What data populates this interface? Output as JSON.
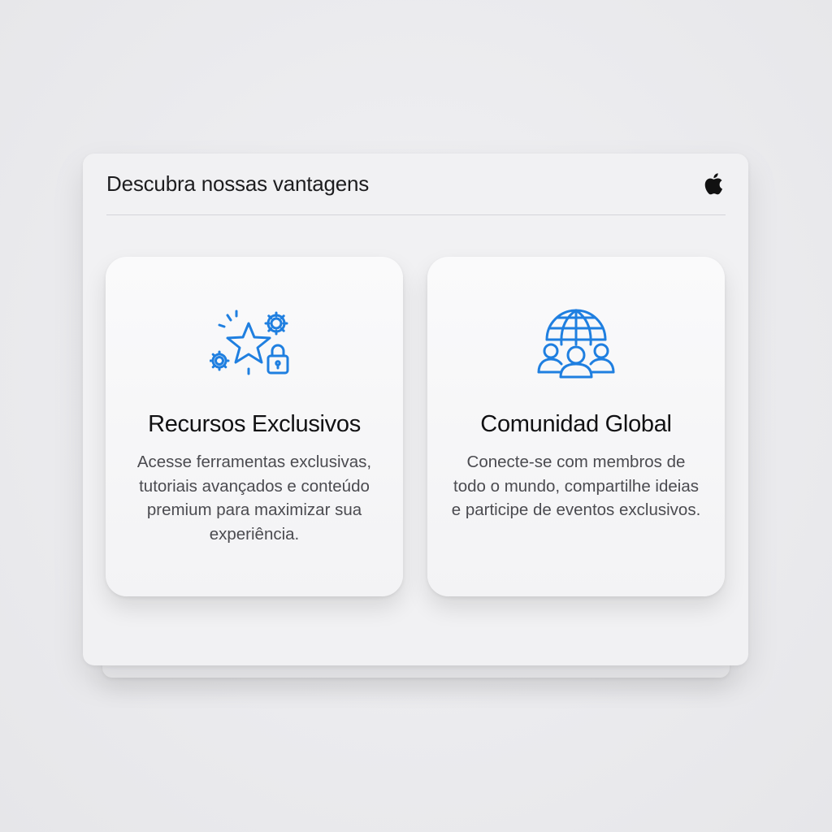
{
  "window": {
    "title": "Descubra nossas vantagens",
    "brand_icon": "apple-logo-icon"
  },
  "cards": [
    {
      "icon": "star-gears-lock-icon",
      "title": "Recursos Exclusivos",
      "description": "Acesse ferramentas exclusivas, tutoriais avançados e conteúdo premium para maximizar sua experiência."
    },
    {
      "icon": "globe-people-icon",
      "title": "Comunidad Global",
      "description": "Conecte-se com membros de todo o mundo, compartilhe ideias e participe de eventos exclusivos."
    }
  ],
  "colors": {
    "accent": "#1f7fe0",
    "background": "#ebebee",
    "panel": "#f1f1f3",
    "card": "#f8f8f9",
    "title_text": "#111113",
    "body_text": "#4b4b50"
  }
}
